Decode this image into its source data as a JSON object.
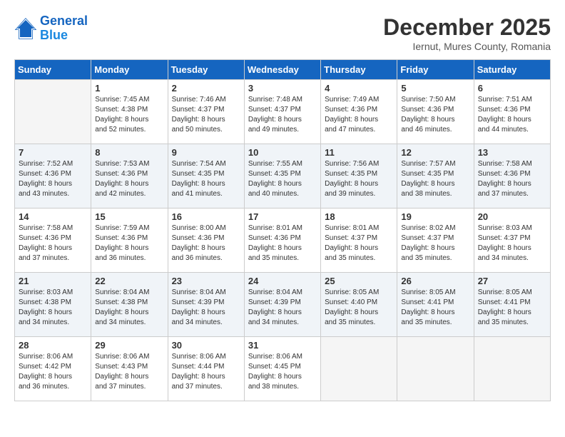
{
  "logo": {
    "line1": "General",
    "line2": "Blue"
  },
  "title": "December 2025",
  "location": "Iernut, Mures County, Romania",
  "days_of_week": [
    "Sunday",
    "Monday",
    "Tuesday",
    "Wednesday",
    "Thursday",
    "Friday",
    "Saturday"
  ],
  "weeks": [
    [
      {
        "day": "",
        "empty": true
      },
      {
        "day": "1",
        "sunrise": "Sunrise: 7:45 AM",
        "sunset": "Sunset: 4:38 PM",
        "daylight": "Daylight: 8 hours and 52 minutes."
      },
      {
        "day": "2",
        "sunrise": "Sunrise: 7:46 AM",
        "sunset": "Sunset: 4:37 PM",
        "daylight": "Daylight: 8 hours and 50 minutes."
      },
      {
        "day": "3",
        "sunrise": "Sunrise: 7:48 AM",
        "sunset": "Sunset: 4:37 PM",
        "daylight": "Daylight: 8 hours and 49 minutes."
      },
      {
        "day": "4",
        "sunrise": "Sunrise: 7:49 AM",
        "sunset": "Sunset: 4:36 PM",
        "daylight": "Daylight: 8 hours and 47 minutes."
      },
      {
        "day": "5",
        "sunrise": "Sunrise: 7:50 AM",
        "sunset": "Sunset: 4:36 PM",
        "daylight": "Daylight: 8 hours and 46 minutes."
      },
      {
        "day": "6",
        "sunrise": "Sunrise: 7:51 AM",
        "sunset": "Sunset: 4:36 PM",
        "daylight": "Daylight: 8 hours and 44 minutes."
      }
    ],
    [
      {
        "day": "7",
        "sunrise": "Sunrise: 7:52 AM",
        "sunset": "Sunset: 4:36 PM",
        "daylight": "Daylight: 8 hours and 43 minutes."
      },
      {
        "day": "8",
        "sunrise": "Sunrise: 7:53 AM",
        "sunset": "Sunset: 4:36 PM",
        "daylight": "Daylight: 8 hours and 42 minutes."
      },
      {
        "day": "9",
        "sunrise": "Sunrise: 7:54 AM",
        "sunset": "Sunset: 4:35 PM",
        "daylight": "Daylight: 8 hours and 41 minutes."
      },
      {
        "day": "10",
        "sunrise": "Sunrise: 7:55 AM",
        "sunset": "Sunset: 4:35 PM",
        "daylight": "Daylight: 8 hours and 40 minutes."
      },
      {
        "day": "11",
        "sunrise": "Sunrise: 7:56 AM",
        "sunset": "Sunset: 4:35 PM",
        "daylight": "Daylight: 8 hours and 39 minutes."
      },
      {
        "day": "12",
        "sunrise": "Sunrise: 7:57 AM",
        "sunset": "Sunset: 4:35 PM",
        "daylight": "Daylight: 8 hours and 38 minutes."
      },
      {
        "day": "13",
        "sunrise": "Sunrise: 7:58 AM",
        "sunset": "Sunset: 4:36 PM",
        "daylight": "Daylight: 8 hours and 37 minutes."
      }
    ],
    [
      {
        "day": "14",
        "sunrise": "Sunrise: 7:58 AM",
        "sunset": "Sunset: 4:36 PM",
        "daylight": "Daylight: 8 hours and 37 minutes."
      },
      {
        "day": "15",
        "sunrise": "Sunrise: 7:59 AM",
        "sunset": "Sunset: 4:36 PM",
        "daylight": "Daylight: 8 hours and 36 minutes."
      },
      {
        "day": "16",
        "sunrise": "Sunrise: 8:00 AM",
        "sunset": "Sunset: 4:36 PM",
        "daylight": "Daylight: 8 hours and 36 minutes."
      },
      {
        "day": "17",
        "sunrise": "Sunrise: 8:01 AM",
        "sunset": "Sunset: 4:36 PM",
        "daylight": "Daylight: 8 hours and 35 minutes."
      },
      {
        "day": "18",
        "sunrise": "Sunrise: 8:01 AM",
        "sunset": "Sunset: 4:37 PM",
        "daylight": "Daylight: 8 hours and 35 minutes."
      },
      {
        "day": "19",
        "sunrise": "Sunrise: 8:02 AM",
        "sunset": "Sunset: 4:37 PM",
        "daylight": "Daylight: 8 hours and 35 minutes."
      },
      {
        "day": "20",
        "sunrise": "Sunrise: 8:03 AM",
        "sunset": "Sunset: 4:37 PM",
        "daylight": "Daylight: 8 hours and 34 minutes."
      }
    ],
    [
      {
        "day": "21",
        "sunrise": "Sunrise: 8:03 AM",
        "sunset": "Sunset: 4:38 PM",
        "daylight": "Daylight: 8 hours and 34 minutes."
      },
      {
        "day": "22",
        "sunrise": "Sunrise: 8:04 AM",
        "sunset": "Sunset: 4:38 PM",
        "daylight": "Daylight: 8 hours and 34 minutes."
      },
      {
        "day": "23",
        "sunrise": "Sunrise: 8:04 AM",
        "sunset": "Sunset: 4:39 PM",
        "daylight": "Daylight: 8 hours and 34 minutes."
      },
      {
        "day": "24",
        "sunrise": "Sunrise: 8:04 AM",
        "sunset": "Sunset: 4:39 PM",
        "daylight": "Daylight: 8 hours and 34 minutes."
      },
      {
        "day": "25",
        "sunrise": "Sunrise: 8:05 AM",
        "sunset": "Sunset: 4:40 PM",
        "daylight": "Daylight: 8 hours and 35 minutes."
      },
      {
        "day": "26",
        "sunrise": "Sunrise: 8:05 AM",
        "sunset": "Sunset: 4:41 PM",
        "daylight": "Daylight: 8 hours and 35 minutes."
      },
      {
        "day": "27",
        "sunrise": "Sunrise: 8:05 AM",
        "sunset": "Sunset: 4:41 PM",
        "daylight": "Daylight: 8 hours and 35 minutes."
      }
    ],
    [
      {
        "day": "28",
        "sunrise": "Sunrise: 8:06 AM",
        "sunset": "Sunset: 4:42 PM",
        "daylight": "Daylight: 8 hours and 36 minutes."
      },
      {
        "day": "29",
        "sunrise": "Sunrise: 8:06 AM",
        "sunset": "Sunset: 4:43 PM",
        "daylight": "Daylight: 8 hours and 37 minutes."
      },
      {
        "day": "30",
        "sunrise": "Sunrise: 8:06 AM",
        "sunset": "Sunset: 4:44 PM",
        "daylight": "Daylight: 8 hours and 37 minutes."
      },
      {
        "day": "31",
        "sunrise": "Sunrise: 8:06 AM",
        "sunset": "Sunset: 4:45 PM",
        "daylight": "Daylight: 8 hours and 38 minutes."
      },
      {
        "day": "",
        "empty": true
      },
      {
        "day": "",
        "empty": true
      },
      {
        "day": "",
        "empty": true
      }
    ]
  ]
}
